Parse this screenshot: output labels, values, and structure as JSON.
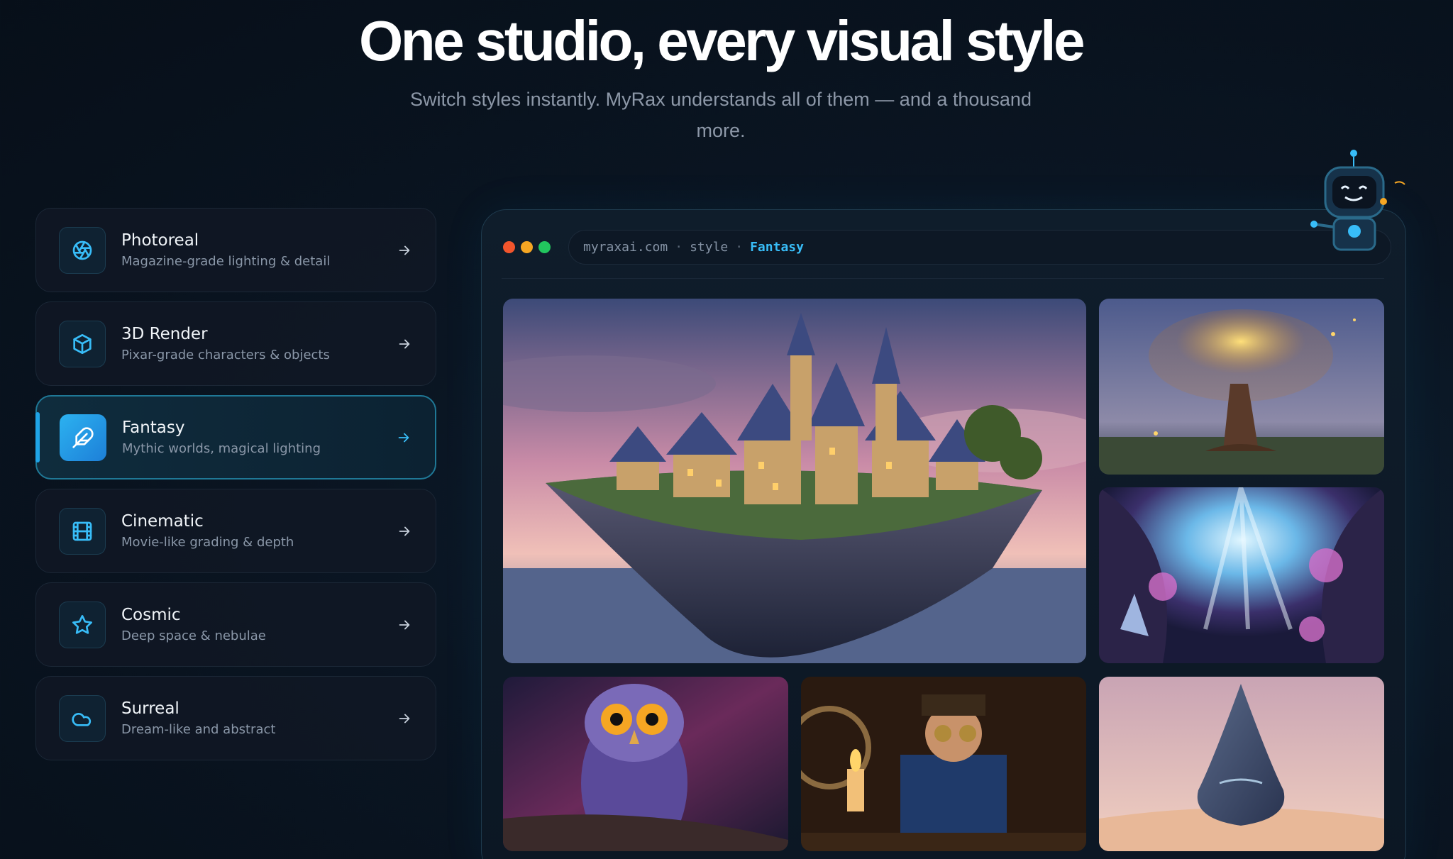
{
  "hero": {
    "title": "One studio, every visual style",
    "subtitle": "Switch styles instantly. MyRax understands all of them — and a thousand more."
  },
  "styles": [
    {
      "name": "Photoreal",
      "desc": "Magazine-grade lighting & detail",
      "icon": "aperture-icon",
      "active": false
    },
    {
      "name": "3D Render",
      "desc": "Pixar-grade characters & objects",
      "icon": "cube-icon",
      "active": false
    },
    {
      "name": "Fantasy",
      "desc": "Mythic worlds, magical lighting",
      "icon": "feather-icon",
      "active": true
    },
    {
      "name": "Cinematic",
      "desc": "Movie-like grading & depth",
      "icon": "film-icon",
      "active": false
    },
    {
      "name": "Cosmic",
      "desc": "Deep space & nebulae",
      "icon": "star-icon",
      "active": false
    },
    {
      "name": "Surreal",
      "desc": "Dream-like and abstract",
      "icon": "cloud-icon",
      "active": false
    }
  ],
  "browser": {
    "url_domain": "myraxai.com",
    "url_sep": "·",
    "url_path": "style",
    "url_active": "Fantasy",
    "dot_colors": [
      "#f2552c",
      "#f5a623",
      "#22c55e"
    ]
  },
  "gallery": [
    {
      "name": "floating-island-castle-image",
      "icon": "castle"
    },
    {
      "name": "glowing-tree-image",
      "icon": "tree"
    },
    {
      "name": "crystal-cave-image",
      "icon": "crystal"
    },
    {
      "name": "cosmic-owl-image",
      "icon": "owl"
    },
    {
      "name": "steampunk-gentleman-image",
      "icon": "steampunk"
    },
    {
      "name": "glass-droplet-desert-image",
      "icon": "droplet"
    }
  ],
  "colors": {
    "accent": "#38bdf8",
    "active_border": "#1f7896"
  }
}
